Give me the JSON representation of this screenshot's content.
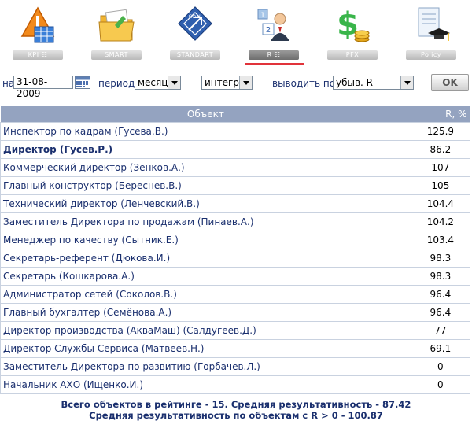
{
  "nav": [
    {
      "label": "KPI ☷",
      "icon": "kpi-warning-table-icon"
    },
    {
      "label": "SMART",
      "icon": "smart-folder-icon"
    },
    {
      "label": "STANDART",
      "icon": "standart-goal-icon"
    },
    {
      "label": "R ☷",
      "icon": "r-person-icon"
    },
    {
      "label": "PFX",
      "icon": "pfx-dollar-coins-icon"
    },
    {
      "label": "Policy",
      "icon": "policy-scroll-cap-icon"
    }
  ],
  "filters": {
    "date_prefix": "на",
    "date_value": "31-08-2009",
    "period_label": "период",
    "period_value": "месяц",
    "type_value": "интеграл",
    "output_label": "выводить по",
    "output_value": "убыв. R",
    "ok_label": "OK"
  },
  "table": {
    "headers": [
      "Объект",
      "R, %"
    ],
    "rows": [
      {
        "name": "Инспектор по кадрам (Гусева.В.)",
        "value": "125.9"
      },
      {
        "name": "Директор (Гусев.Р.)",
        "value": "86.2"
      },
      {
        "name": "Коммерческий директор (Зенков.А.)",
        "value": "107"
      },
      {
        "name": "Главный конструктор (Береснев.В.)",
        "value": "105"
      },
      {
        "name": "Технический директор (Ленчевский.В.)",
        "value": "104.4"
      },
      {
        "name": "Заместитель Директора по продажам (Пинаев.А.)",
        "value": "104.2"
      },
      {
        "name": "Менеджер по качеству (Сытник.Е.)",
        "value": "103.4"
      },
      {
        "name": "Секретарь-референт (Дюкова.И.)",
        "value": "98.3"
      },
      {
        "name": "Секретарь (Кошкарова.А.)",
        "value": "98.3"
      },
      {
        "name": "Администратор сетей (Соколов.В.)",
        "value": "96.4"
      },
      {
        "name": "Главный бухгалтер (Семёнова.А.)",
        "value": "96.4"
      },
      {
        "name": "Директор производства (АкваМаш) (Салдугеев.Д.)",
        "value": "77"
      },
      {
        "name": "Директор Службы Сервиса (Матвеев.Н.)",
        "value": "69.1"
      },
      {
        "name": "Заместитель Директора по развитию (Горбачев.Л.)",
        "value": "0"
      },
      {
        "name": "Начальник АХО (Ищенко.И.)",
        "value": "0"
      }
    ]
  },
  "summary": {
    "line1": "Всего объектов в рейтинге - 15. Средняя результативность - 87.42",
    "line2": "Средняя результативность по объектам с  R > 0 - 100.87"
  },
  "colors": {
    "header_bg": "#94a3c0",
    "text": "#1a2f6e",
    "active_underline": "#e1333a"
  }
}
